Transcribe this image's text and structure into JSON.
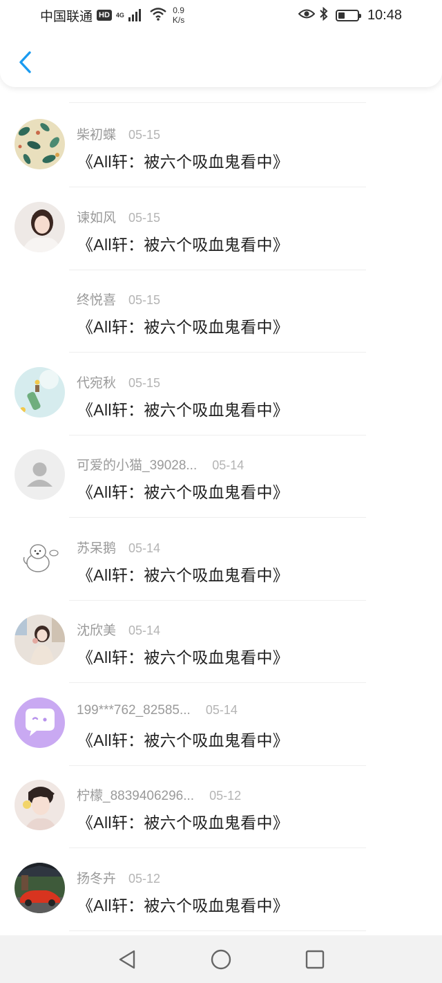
{
  "status_bar": {
    "carrier": "中国联通",
    "hd": "HD",
    "network": "4G",
    "net_speed_value": "0.9",
    "net_speed_unit": "K/s",
    "time": "10:48",
    "battery_level": 0.35,
    "icons": [
      "hd-icon",
      "signal-icon",
      "wifi-icon",
      "eye-icon",
      "bluetooth-icon",
      "battery-icon"
    ]
  },
  "header": {
    "back_icon": "chevron-left-icon",
    "accent_color": "#1a9bf0"
  },
  "messages": [
    {
      "sender": "柴初蝶",
      "date": "05-15",
      "title": "《All轩：被六个吸血鬼看中》",
      "avatar": "pattern-leaves"
    },
    {
      "sender": "谏如风",
      "date": "05-15",
      "title": "《All轩：被六个吸血鬼看中》",
      "avatar": "photo-girl"
    },
    {
      "sender": "终悦喜",
      "date": "05-15",
      "title": "《All轩：被六个吸血鬼看中》",
      "avatar": "none"
    },
    {
      "sender": "代宛秋",
      "date": "05-15",
      "title": "《All轩：被六个吸血鬼看中》",
      "avatar": "photo-bottle"
    },
    {
      "sender": "可爱的小猫_39028...",
      "date": "05-14",
      "title": "《All轩：被六个吸血鬼看中》",
      "avatar": "default-user"
    },
    {
      "sender": "苏呆鹅",
      "date": "05-14",
      "title": "《All轩：被六个吸血鬼看中》",
      "avatar": "cartoon-dog"
    },
    {
      "sender": "沈欣美",
      "date": "05-14",
      "title": "《All轩：被六个吸血鬼看中》",
      "avatar": "photo-child"
    },
    {
      "sender": "199***762_82585...",
      "date": "05-14",
      "title": "《All轩：被六个吸血鬼看中》",
      "avatar": "chat-bubble"
    },
    {
      "sender": "柠檬_8839406296...",
      "date": "05-12",
      "title": "《All轩：被六个吸血鬼看中》",
      "avatar": "photo-boy"
    },
    {
      "sender": "扬冬卉",
      "date": "05-12",
      "title": "《All轩：被六个吸血鬼看中》",
      "avatar": "photo-car"
    }
  ],
  "nav_bar": {
    "buttons": [
      "back-triangle-icon",
      "home-circle-icon",
      "recents-square-icon"
    ]
  }
}
